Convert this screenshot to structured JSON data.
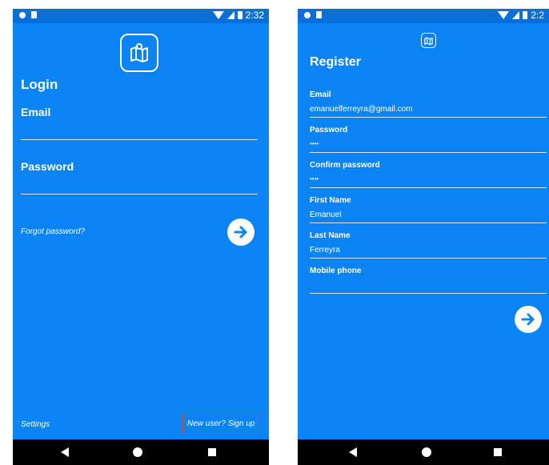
{
  "status": {
    "time_left": "2:32",
    "time_right": "2:2"
  },
  "login": {
    "title": "Login",
    "email_label": "Email",
    "email_value": "",
    "password_label": "Password",
    "password_value": "",
    "forgot_password": "Forgot password?",
    "settings": "Settings",
    "signup": "New user? Sign up"
  },
  "register": {
    "title": "Register",
    "email_label": "Email",
    "email_value": "emanuelferreyra@gmail.com",
    "password_label": "Password",
    "password_value": "••••",
    "confirm_label": "Confirm password",
    "confirm_value": "••••",
    "first_name_label": "First Name",
    "first_name_value": "Emanuel",
    "last_name_label": "Last Name",
    "last_name_value": "Ferreyra",
    "mobile_label": "Mobile phone",
    "mobile_value": ""
  },
  "icons": [
    "map-logo-icon",
    "arrow-right-icon",
    "back-icon",
    "home-icon",
    "recents-icon",
    "wifi-icon",
    "signal-icon",
    "battery-icon"
  ],
  "colors": {
    "background": "#0a84f4",
    "highlight": "#e53935"
  }
}
